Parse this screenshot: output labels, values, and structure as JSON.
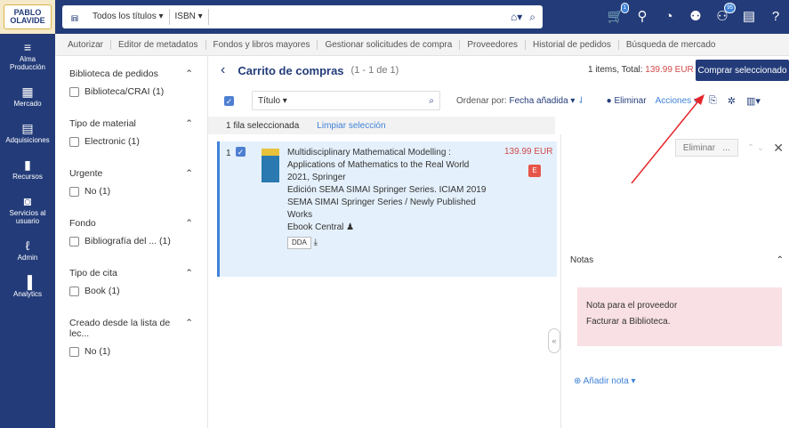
{
  "brand": {
    "logo_line1": "PABLO",
    "logo_line2": "OLAVIDE"
  },
  "search": {
    "scope": "Todos los títulos ▾",
    "field": "ISBN ▾",
    "value": ""
  },
  "top_icons": [
    {
      "name": "cart-icon",
      "glyph": "🛒",
      "badge": "1"
    },
    {
      "name": "location-icon",
      "glyph": "⚲",
      "badge": ""
    },
    {
      "name": "tasks-icon",
      "glyph": "◔",
      "badge": ""
    },
    {
      "name": "user-icon",
      "glyph": "⚉",
      "badge": ""
    },
    {
      "name": "users-icon",
      "glyph": "⚇",
      "badge": "95"
    },
    {
      "name": "clipboard-icon",
      "glyph": "▤",
      "badge": ""
    },
    {
      "name": "help-icon",
      "glyph": "?",
      "badge": ""
    }
  ],
  "sidebar": [
    {
      "label": "Alma\nProducción",
      "glyph": "≡"
    },
    {
      "label": "Mercado",
      "glyph": "▦"
    },
    {
      "label": "Adquisiciones",
      "glyph": "▤"
    },
    {
      "label": "Recursos",
      "glyph": "▮"
    },
    {
      "label": "Servicios al usuario",
      "glyph": "◙"
    },
    {
      "label": "Admin",
      "glyph": "ℓ"
    },
    {
      "label": "Analytics",
      "glyph": "▐"
    }
  ],
  "submenu": [
    "Autorizar",
    "Editor de metadatos",
    "Fondos y libros mayores",
    "Gestionar solicitudes de compra",
    "Proveedores",
    "Historial de pedidos",
    "Búsqueda de mercado"
  ],
  "facets": [
    {
      "title": "Biblioteca de pedidos",
      "option": "Biblioteca/CRAI (1)"
    },
    {
      "title": "Tipo de material",
      "option": "Electronic (1)"
    },
    {
      "title": "Urgente",
      "option": "No (1)"
    },
    {
      "title": "Fondo",
      "option": "Bibliografía del ...  (1)"
    },
    {
      "title": "Tipo de cita",
      "option": "Book (1)"
    },
    {
      "title": "Creado desde la lista de lec...",
      "option": "No (1)"
    }
  ],
  "cart": {
    "title": "Carrito de compras",
    "count": "(1 - 1 de 1)",
    "total_prefix": "1 items, Total: ",
    "total_value": "139.99 EUR",
    "buy_label": "Comprar seleccionado",
    "field": "Título ▾",
    "sort_label": "Ordenar por:",
    "sort_value": "Fecha añadida ▾",
    "delete_label": "Eliminar",
    "actions_label": "Acciones ▾",
    "selected": "1 fila seleccionada",
    "clear_selection": "Limpiar selección"
  },
  "item": {
    "num": "1",
    "title": "Multidisciplinary Mathematical Modelling : Applications of Mathematics to the Real World",
    "year_pub": "2021, Springer",
    "edition": "Edición SEMA SIMAI Springer Series. ICIAM 2019",
    "series": "SEMA SIMAI Springer Series / Newly Published Works",
    "vendor": "Ebook Central",
    "price": "139.99 EUR",
    "badge": "E",
    "tag": "DDA"
  },
  "panel": {
    "delete_label": "Eliminar",
    "more_label": "...",
    "notes_title": "Notas",
    "note_title": "Nota para el proveedor",
    "note_text": "Facturar a Biblioteca.",
    "add_note": "Añadir nota ▾"
  }
}
